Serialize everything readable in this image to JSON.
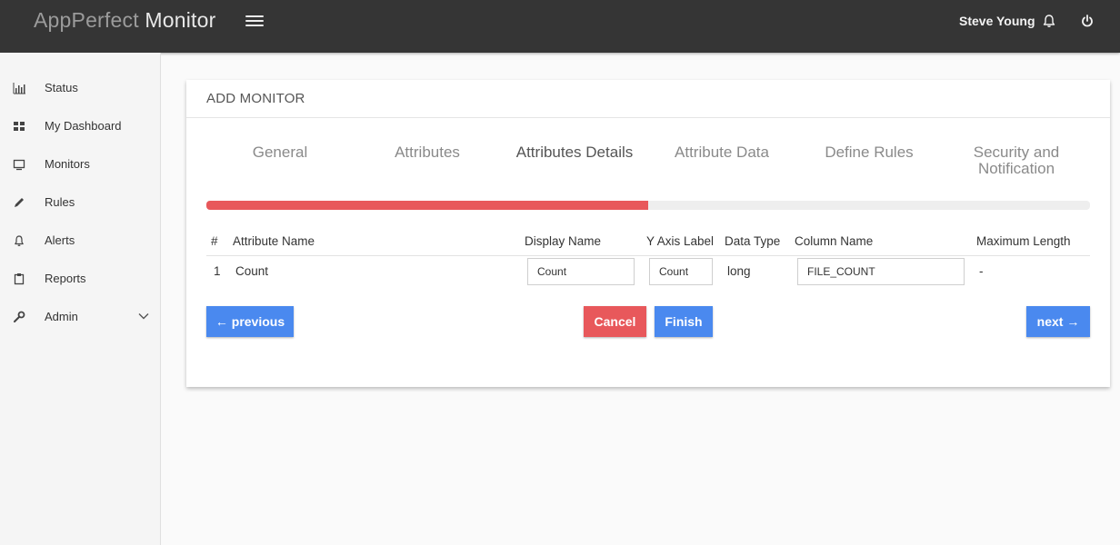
{
  "app": {
    "brand_light": "AppPerfect",
    "brand_strong": "Monitor",
    "user_name": "Steve Young"
  },
  "sidebar": {
    "items": [
      {
        "label": "Status",
        "icon": "bar-chart-icon"
      },
      {
        "label": "My Dashboard",
        "icon": "grid-icon"
      },
      {
        "label": "Monitors",
        "icon": "monitor-icon"
      },
      {
        "label": "Rules",
        "icon": "pencil-icon"
      },
      {
        "label": "Alerts",
        "icon": "bell-icon"
      },
      {
        "label": "Reports",
        "icon": "clipboard-icon"
      },
      {
        "label": "Admin",
        "icon": "wrench-icon",
        "expandable": true
      }
    ]
  },
  "card": {
    "title": "ADD MONITOR",
    "steps": [
      {
        "label": "General"
      },
      {
        "label": "Attributes"
      },
      {
        "label": "Attributes Details",
        "active": true
      },
      {
        "label": "Attribute Data"
      },
      {
        "label": "Define Rules"
      },
      {
        "label": "Security and Notification"
      }
    ],
    "progress_percent": 50
  },
  "table": {
    "headers": [
      "#",
      "Attribute Name",
      "Display Name",
      "Y Axis Label",
      "Data Type",
      "Column Name",
      "Maximum Length"
    ],
    "rows": [
      {
        "index": "1",
        "attribute_name": "Count",
        "display_name": "Count",
        "y_axis_label": "Count",
        "data_type": "long",
        "column_name": "FILE_COUNT",
        "maximum_length": "-"
      }
    ]
  },
  "buttons": {
    "previous": "← previous",
    "cancel": "Cancel",
    "finish": "Finish",
    "next": "next →"
  },
  "colors": {
    "topbar": "#353535",
    "accent_blue": "#4a89ef",
    "accent_red": "#e8585b"
  }
}
